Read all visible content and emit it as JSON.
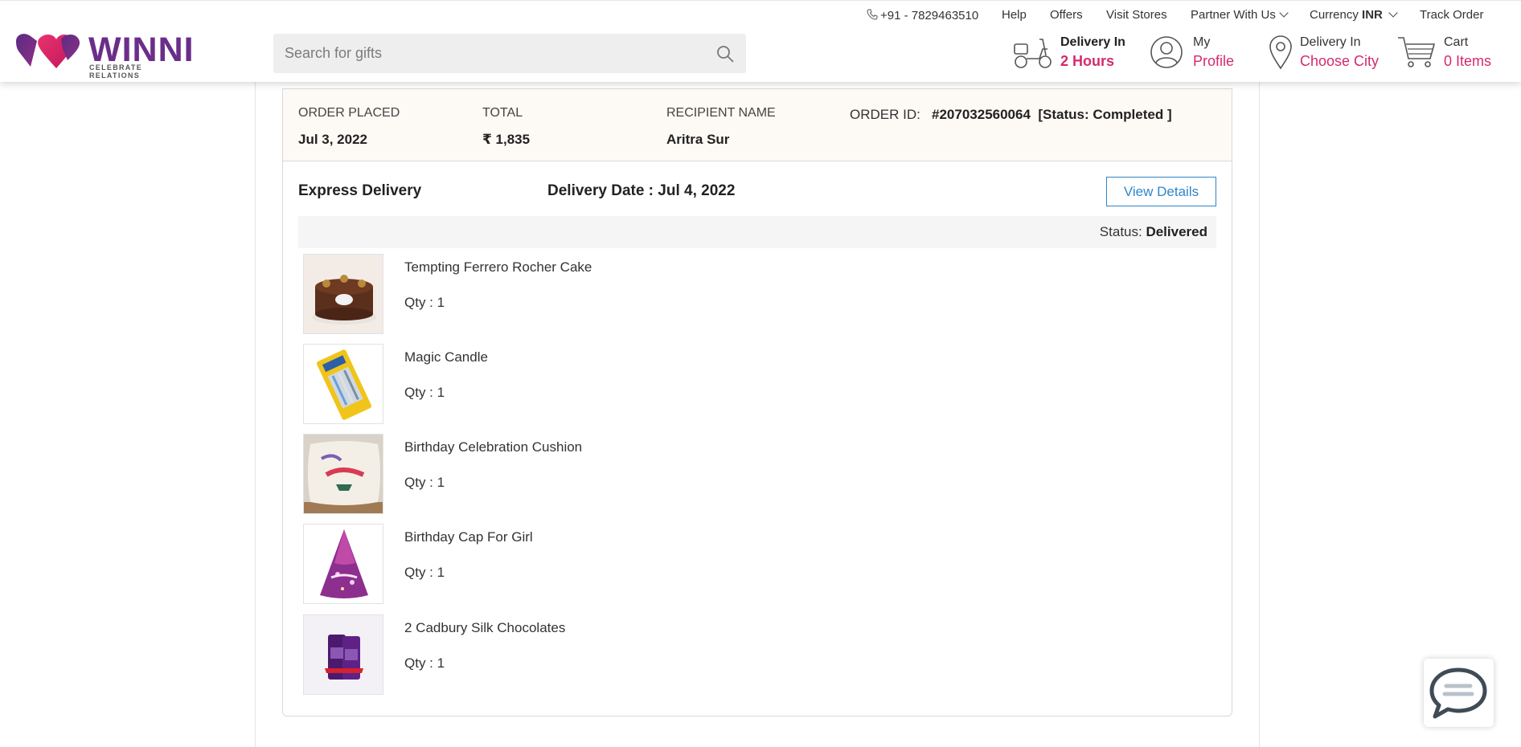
{
  "topnav": {
    "phone": "+91 - 7829463510",
    "help": "Help",
    "offers": "Offers",
    "visit_stores": "Visit Stores",
    "partner": "Partner With Us",
    "currency_label": "Currency",
    "currency_value": "INR",
    "track_order": "Track Order"
  },
  "logo": {
    "word": "WINNI",
    "tagline": "CELEBRATE RELATIONS"
  },
  "search": {
    "placeholder": "Search for gifts",
    "value": ""
  },
  "header": {
    "delivery_fast": {
      "line1": "Delivery In",
      "line2": "2 Hours"
    },
    "profile": {
      "line1": "My",
      "line2": "Profile"
    },
    "delivery_city": {
      "line1": "Delivery In",
      "line2": "Choose City"
    },
    "cart": {
      "line1": "Cart",
      "line2": "0 Items"
    }
  },
  "order": {
    "placed_label": "ORDER PLACED",
    "placed_value": "Jul 3, 2022",
    "total_label": "TOTAL",
    "total_value": "₹ 1,835",
    "recipient_label": "RECIPIENT NAME",
    "recipient_value": "Aritra Sur",
    "id_label": "ORDER ID:",
    "id_value": "#207032560064",
    "id_status": "[Status: Completed ]",
    "delivery_type": "Express Delivery",
    "delivery_date": "Delivery Date : Jul 4, 2022",
    "view_details": "View Details",
    "status_label": "Status:",
    "status_value": "Delivered",
    "items": [
      {
        "name": "Tempting Ferrero Rocher Cake",
        "qty": "Qty : 1"
      },
      {
        "name": "Magic Candle",
        "qty": "Qty : 1"
      },
      {
        "name": "Birthday Celebration Cushion",
        "qty": "Qty : 1"
      },
      {
        "name": "Birthday Cap For Girl",
        "qty": "Qty : 1"
      },
      {
        "name": "2 Cadbury Silk Chocolates",
        "qty": "Qty : 1"
      }
    ]
  },
  "colors": {
    "brand_pink": "#d42a6f",
    "brand_purple": "#6b2d8a",
    "link_blue": "#2f86c9"
  }
}
